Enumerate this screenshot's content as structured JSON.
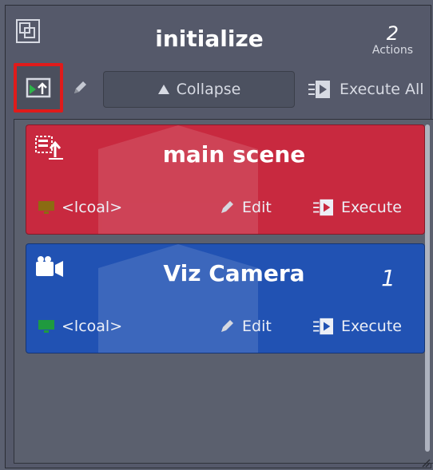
{
  "header": {
    "title": "initialize",
    "count": "2",
    "count_label": "Actions",
    "icon": "template-icon"
  },
  "toolbar": {
    "add_icon": "add-action-icon",
    "edit_icon": "pencil-icon",
    "collapse_label": "Collapse",
    "execute_all_label": "Execute All"
  },
  "actions": [
    {
      "title": "main scene",
      "icon": "load-scene-icon",
      "count": "",
      "host": "<lcoal>",
      "edit_label": "Edit",
      "execute_label": "Execute",
      "color": "#c8293f",
      "host_color": "#8b6b12"
    },
    {
      "title": "Viz Camera",
      "icon": "camera-icon",
      "count": "1",
      "host": "<lcoal>",
      "edit_label": "Edit",
      "execute_label": "Execute",
      "color": "#2152b3",
      "host_color": "#1f9a3f"
    }
  ],
  "colors": {
    "highlight": "#e01b1b",
    "panel": "#55596a"
  }
}
